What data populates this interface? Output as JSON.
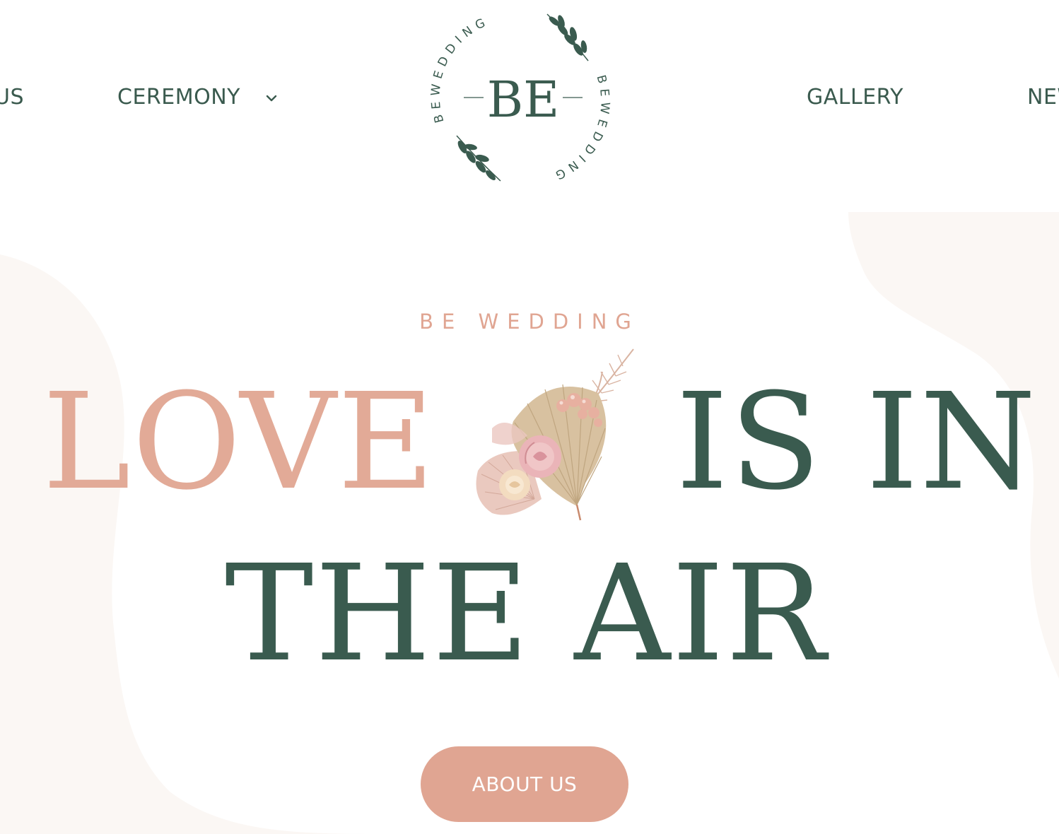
{
  "nav": {
    "items": [
      {
        "label": "US"
      },
      {
        "label": "CEREMONY"
      },
      {
        "label": "GALLERY"
      },
      {
        "label": "NEW"
      }
    ]
  },
  "logo": {
    "monogram": "BE",
    "ring_text": "BEWEDDING"
  },
  "hero": {
    "eyebrow": "BE WEDDING",
    "line1_a": "LOVE",
    "line1_b": "IS IN",
    "line2": "THE AIR",
    "cta_label": "ABOUT US"
  },
  "colors": {
    "green": "#3a5b4f",
    "pink": "#e0a592",
    "background": "#ffffff",
    "blob": "#fbf7f4"
  }
}
